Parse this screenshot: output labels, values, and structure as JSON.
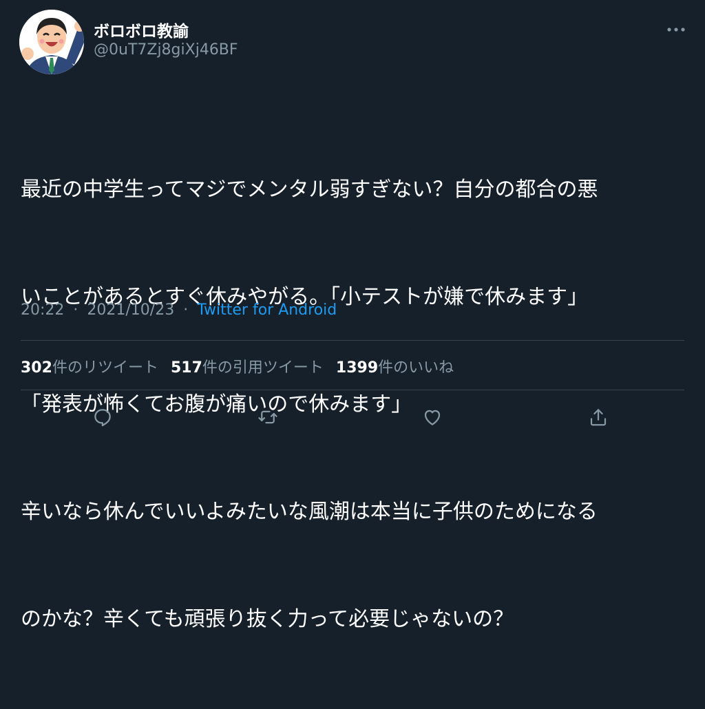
{
  "user": {
    "display_name": "ボロボロ教諭",
    "handle": "@0uT7Zj8giXj46BF",
    "avatar_icon": "teacher-avatar-icon"
  },
  "tweet": {
    "lines": [
      "最近の中学生ってマジでメンタル弱すぎない？自分の都合の悪",
      "いことがあるとすぐ休みやがる。「小テストが嫌で休みます」",
      "「発表が怖くてお腹が痛いので休みます」",
      "辛いなら休んでいいよみたいな風潮は本当に子供のためになる",
      "のかな？辛くても頑張り抜く力って必要じゃないの？"
    ],
    "time": "20:22",
    "date": "2021/10/23",
    "separator": "·",
    "source": "Twitter for Android"
  },
  "stats": {
    "retweets": {
      "count": "302",
      "label": "件のリツイート"
    },
    "quotes": {
      "count": "517",
      "label": "件の引用ツイート"
    },
    "likes": {
      "count": "1399",
      "label": "件のいいね"
    }
  },
  "actions": {
    "reply_icon": "reply-icon",
    "retweet_icon": "retweet-icon",
    "like_icon": "heart-icon",
    "share_icon": "share-icon"
  },
  "colors": {
    "background": "#15202b",
    "text": "#ffffff",
    "secondary_text": "#8899a6",
    "link": "#1d9bf0",
    "divider": "#38444d"
  }
}
